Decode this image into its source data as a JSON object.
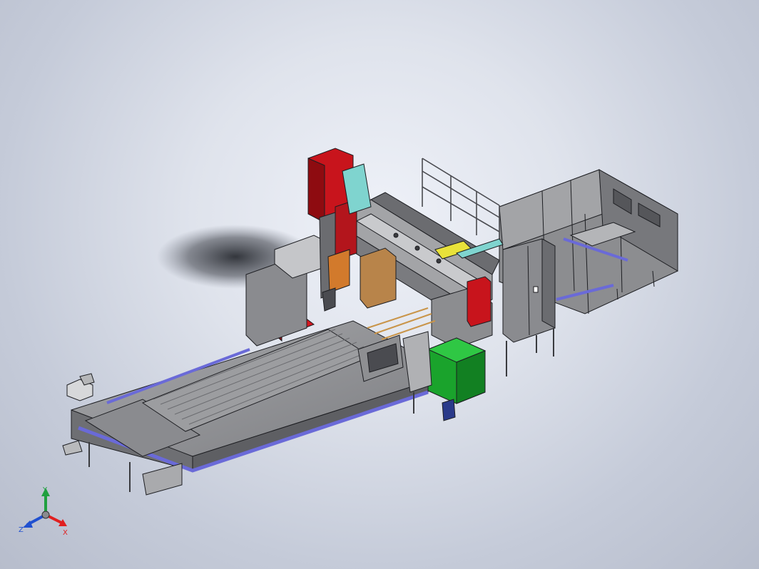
{
  "triad": {
    "y_label": "Y",
    "x_label": "X",
    "z_label": "Z",
    "colors": {
      "x": "#e02020",
      "y": "#20a040",
      "z": "#2050d0"
    }
  },
  "model": {
    "colors": {
      "frame": "#8e8f92",
      "frame_dark": "#5b5c60",
      "frame_light": "#b9babc",
      "accent_red": "#c8141c",
      "accent_green": "#1aa32c",
      "blue_strip": "#6a6ad8",
      "orange": "#d27a2c",
      "cyan": "#7fd4cf",
      "yellow": "#e8e23a"
    }
  }
}
